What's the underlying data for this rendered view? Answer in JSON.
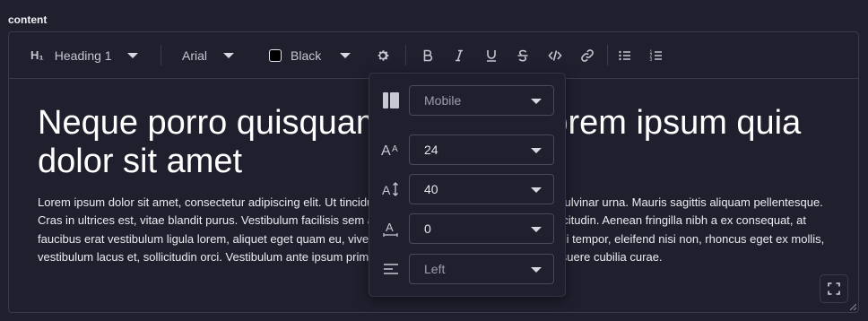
{
  "field": {
    "label": "content"
  },
  "toolbar": {
    "heading_icon": "H₁",
    "heading_value": "Heading 1",
    "font_value": "Arial",
    "color_value": "Black",
    "color_swatch": "#000000",
    "icons": [
      "gear-icon",
      "bold-icon",
      "italic-icon",
      "underline-icon",
      "strikethrough-icon",
      "code-icon",
      "link-icon",
      "bulleted-list-icon",
      "numbered-list-icon"
    ]
  },
  "content": {
    "heading": "Neque porro quisquam est qui dolorem ipsum quia dolor sit amet",
    "paragraph": "Lorem ipsum dolor sit amet, consectetur adipiscing elit. Ut tincidunt velit eu ante egestas, et posuere pulvinar urna. Mauris sagittis aliquam pellentesque. Cras in ultrices est, vitae blandit purus. Vestibulum facilisis sem at urna volutpat, id dictum mauris sollicitudin. Aenean fringilla nibh a ex consequat, at faucibus erat vestibulum ligula lorem, aliquet eget quam eu, viverra lobortis nunc. Suspendisse quis dui tempor, eleifend nisi non, rhoncus eget ex mollis, vestibulum lacus et, sollicitudin orci. Vestibulum ante ipsum primis in faucibus orci luctus et ultrices posuere cubilia curae."
  },
  "popover": {
    "device": "Mobile",
    "font_size": "24",
    "line_height": "40",
    "letter_spacing": "0",
    "alignment": "Left"
  },
  "colors": {
    "background": "#1f1f2e",
    "border": "#3a3a4c",
    "text": "#e6e6ef"
  }
}
